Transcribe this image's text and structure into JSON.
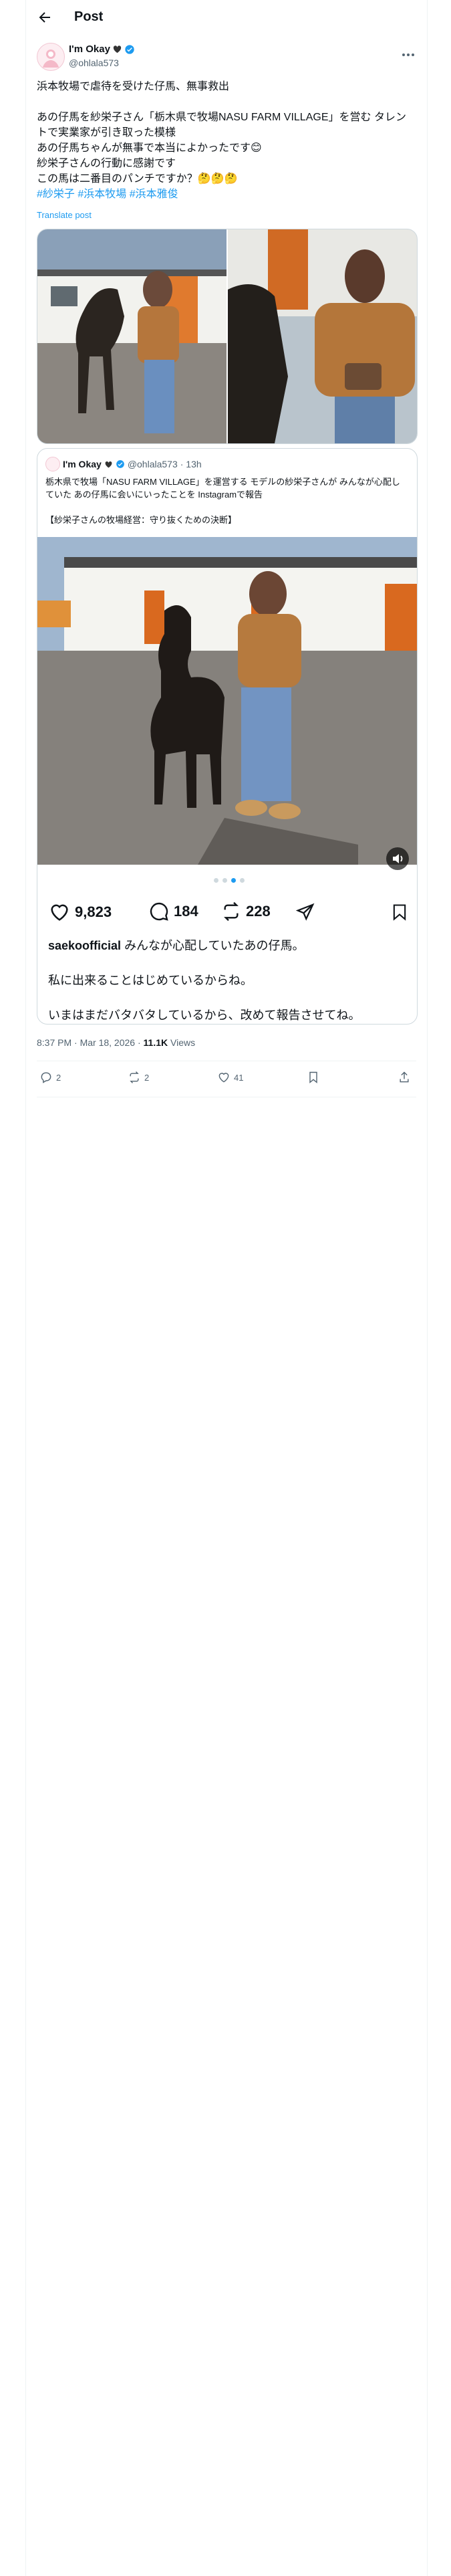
{
  "header": {
    "title": "Post"
  },
  "author": {
    "name": "I'm Okay",
    "handle": "@ohlala573"
  },
  "tweet": {
    "lines": [
      "浜本牧場で虐待を受けた仔馬、無事救出",
      "",
      "あの仔馬を紗栄子さん「栃木県で牧場NASU FARM VILLAGE」を営む タレントで実業家が引き取った模様",
      "あの仔馬ちゃんが無事で本当によかったです😊",
      "紗栄子さんの行動に感謝です",
      "この馬は二番目のパンチですか？🤔🤔🤔"
    ],
    "hashtags": "#紗栄子 #浜本牧場 #浜本雅俊",
    "translate": "Translate post"
  },
  "quote": {
    "name": "I'm Okay",
    "handle": "@ohlala573",
    "time": "· 13h",
    "text1": "栃木県で牧場「NASU FARM VILLAGE」を運営する モデルの紗栄子さんが みんなが心配していた あの仔馬に会いにいったことを Instagramで報告",
    "text2": "【紗栄子さんの牧場経営：守り抜くための決断】",
    "ig": {
      "likes": "9,823",
      "comments": "184",
      "reposts": "228",
      "caption_user": "saekoofficial",
      "caption_lines": [
        "みんなが心配していたあの仔馬。",
        "私に出来ることはじめているからね。",
        "いまはまだバタバタしているから、改めて報告させてね。"
      ]
    }
  },
  "meta": {
    "time": "8:37 PM · Mar 18, 2026 · ",
    "views_count": "11.1K",
    "views_label": " Views"
  },
  "actions": {
    "replies": "2",
    "reposts": "2",
    "likes": "41"
  },
  "colors": {
    "accent": "#1d9bf0",
    "text": "#0f1419",
    "muted": "#536471",
    "border": "#cfd9de"
  }
}
